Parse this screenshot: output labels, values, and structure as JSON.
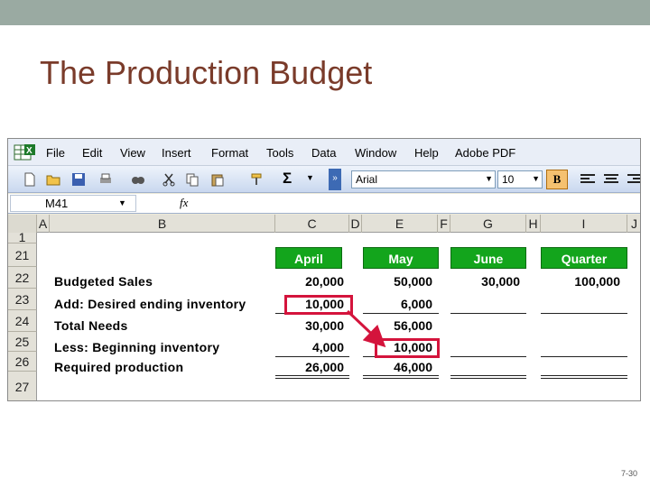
{
  "slide": {
    "title": "The Production Budget",
    "page_number": "7-30"
  },
  "menu": [
    "File",
    "Edit",
    "View",
    "Insert",
    "Format",
    "Tools",
    "Data",
    "Window",
    "Help",
    "Adobe PDF"
  ],
  "toolbar": {
    "font": "Arial",
    "size": "10",
    "bold": "B",
    "autosum": "Σ",
    "overflow": "»"
  },
  "formula_bar": {
    "name_box": "M41",
    "fx": "fx"
  },
  "columns": [
    "A",
    "B",
    "C",
    "D",
    "E",
    "F",
    "G",
    "H",
    "I",
    "J"
  ],
  "rows": [
    "1",
    "21",
    "22",
    "23",
    "24",
    "25",
    "26",
    "27"
  ],
  "headers": {
    "april": "April",
    "may": "May",
    "june": "June",
    "quarter": "Quarter"
  },
  "labels": {
    "r22": "Budgeted Sales",
    "r23": "Add: Desired ending inventory",
    "r24": "Total Needs",
    "r25": "Less: Beginning inventory",
    "r26": "Required production"
  },
  "values": {
    "april": {
      "sales": "20,000",
      "ending": "10,000",
      "total": "30,000",
      "beginning": "4,000",
      "required": "26,000"
    },
    "may": {
      "sales": "50,000",
      "ending": "6,000",
      "total": "56,000",
      "beginning": "10,000",
      "required": "46,000"
    },
    "june": {
      "sales": "30,000"
    },
    "quarter": {
      "sales": "100,000"
    }
  },
  "colors": {
    "header_green": "#13a51c",
    "highlight_red": "#d4143c",
    "title": "#7a3b2a"
  }
}
